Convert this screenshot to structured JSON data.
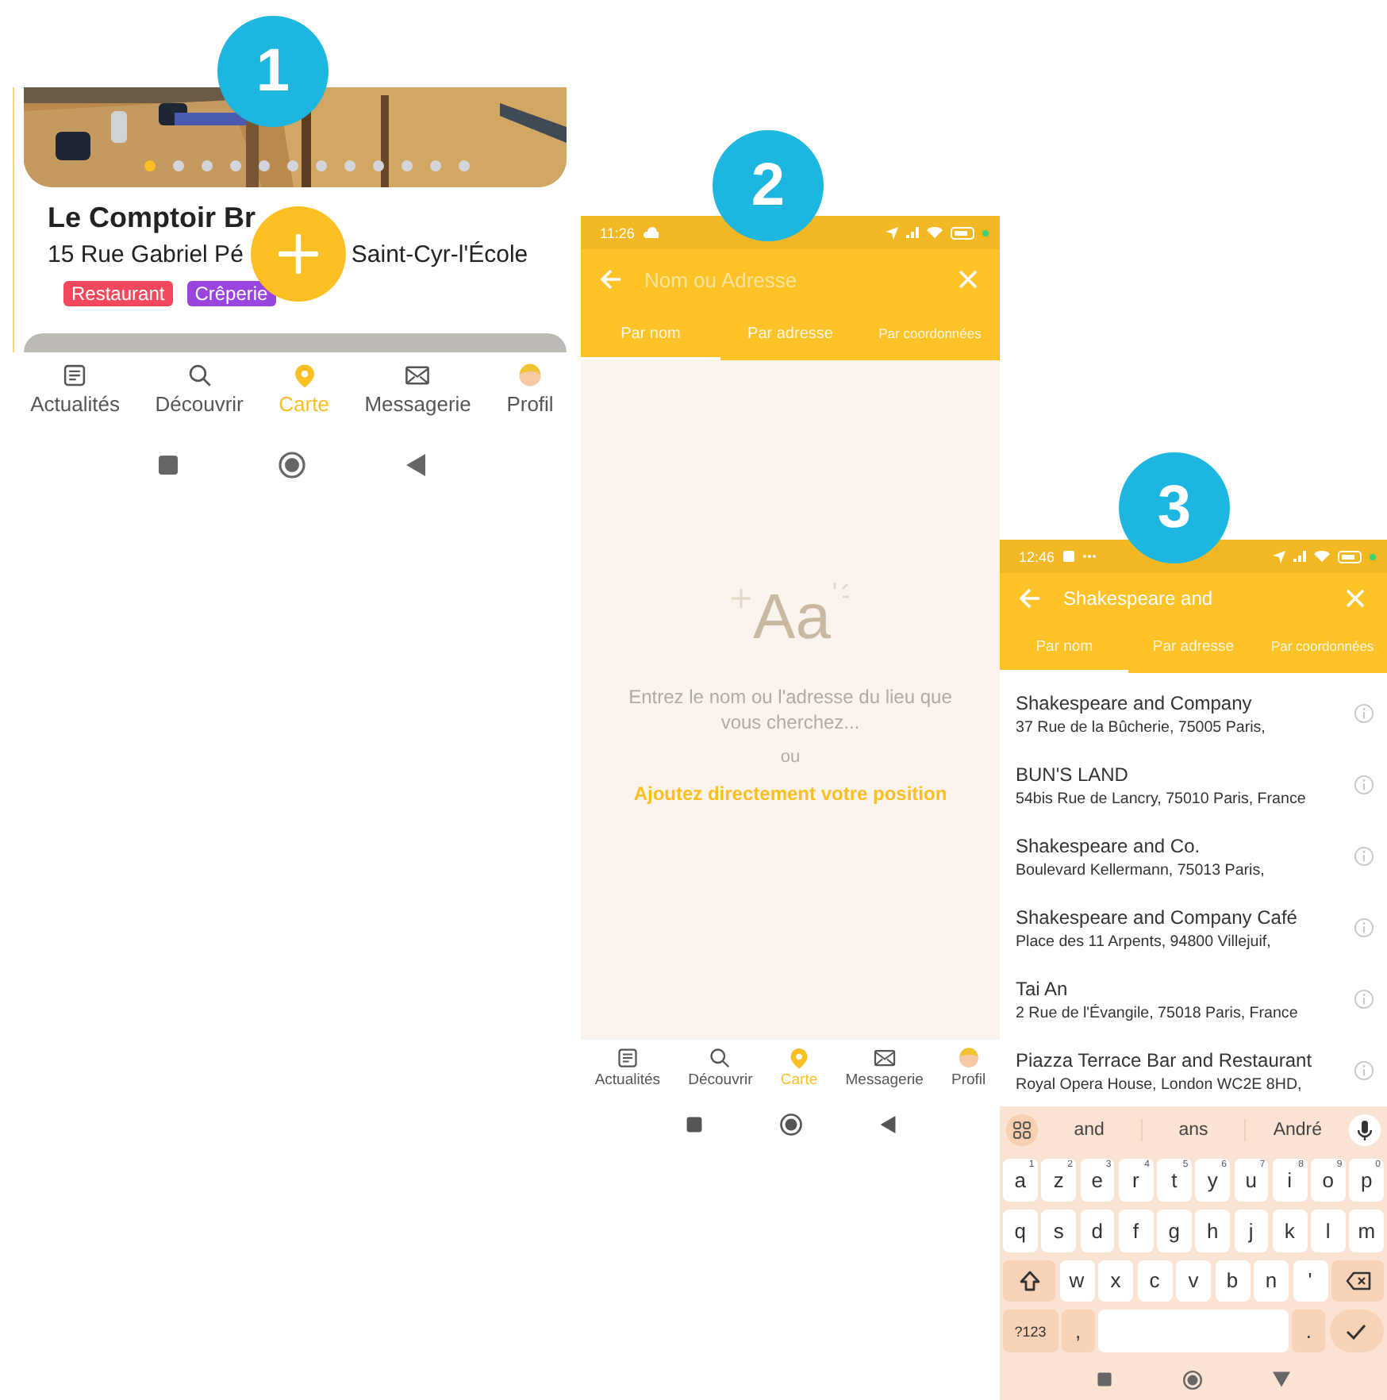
{
  "screen_1": {
    "step": "1",
    "photo": {
      "kind": "picture",
      "dots": [
        {
          "selected": true
        },
        {
          "selected": false
        },
        {
          "selected": false
        },
        {
          "selected": false
        },
        {
          "selected": false
        },
        {
          "selected": false
        },
        {
          "selected": false
        },
        {
          "selected": false
        },
        {
          "selected": false
        },
        {
          "selected": false
        },
        {
          "selected": false
        },
        {
          "selected": false
        }
      ]
    },
    "place": {
      "name": "Le Comptoir Br",
      "address_start": "15 Rue Gabriel Pé",
      "address_end": "Saint-Cyr-l'École",
      "tags": [
        {
          "label": "Restaurant",
          "color": "#f2475c"
        },
        {
          "label": "Crêperie",
          "color": "#9a44e0"
        }
      ]
    },
    "nav": [
      {
        "kind": "news",
        "label": "Actualités",
        "selected": false
      },
      {
        "kind": "search",
        "label": "Découvrir",
        "selected": false
      },
      {
        "kind": "map",
        "label": "Carte",
        "selected": true
      },
      {
        "kind": "mail",
        "label": "Messagerie",
        "selected": false
      },
      {
        "kind": "avatar",
        "label": "Profil",
        "selected": false
      }
    ]
  },
  "screen_2": {
    "step": "2",
    "status": {
      "time": "11:26"
    },
    "search": {
      "placeholder": "Nom ou Adresse"
    },
    "tabs": [
      {
        "label": "Par nom",
        "selected": true
      },
      {
        "label": "Par adresse",
        "selected": false
      },
      {
        "label": "Par coordonnées",
        "selected": false
      }
    ],
    "empty": {
      "illustration": "Aa",
      "message": "Entrez le nom ou l'adresse du lieu que vous cherchez...",
      "separator": "ou",
      "link": "Ajoutez directement votre position"
    },
    "nav": [
      {
        "kind": "news",
        "label": "Actualités",
        "selected": false
      },
      {
        "kind": "search",
        "label": "Découvrir",
        "selected": false
      },
      {
        "kind": "map",
        "label": "Carte",
        "selected": true
      },
      {
        "kind": "mail",
        "label": "Messagerie",
        "selected": false
      },
      {
        "kind": "avatar",
        "label": "Profil",
        "selected": false
      }
    ]
  },
  "screen_3": {
    "step": "3",
    "status": {
      "time": "12:46"
    },
    "search": {
      "value": "Shakespeare and"
    },
    "tabs": [
      {
        "label": "Par nom",
        "selected": true
      },
      {
        "label": "Par adresse",
        "selected": false
      },
      {
        "label": "Par coordonnées",
        "selected": false
      }
    ],
    "results": [
      {
        "name": "Shakespeare and Company",
        "address": "37 Rue de la Bûcherie, 75005 Paris,"
      },
      {
        "name": "BUN'S LAND",
        "address": "54bis Rue de Lancry, 75010 Paris, France"
      },
      {
        "name": "Shakespeare and Co.",
        "address": "Boulevard Kellermann, 75013 Paris,"
      },
      {
        "name": "Shakespeare and Company Café",
        "address": "Place des 11 Arpents, 94800 Villejuif,"
      },
      {
        "name": "Tai An",
        "address": "2 Rue de l'Évangile, 75018 Paris, France"
      },
      {
        "name": "Piazza Terrace Bar and Restaurant",
        "address": "Royal Opera House, London WC2E 8HD,"
      }
    ],
    "keyboard": {
      "suggestions": [
        "and",
        "ans",
        "André"
      ],
      "rows": [
        [
          {
            "kind": "letter",
            "label": "a",
            "hint": "1"
          },
          {
            "kind": "letter",
            "label": "z",
            "hint": "2"
          },
          {
            "kind": "letter",
            "label": "e",
            "hint": "3"
          },
          {
            "kind": "letter",
            "label": "r",
            "hint": "4"
          },
          {
            "kind": "letter",
            "label": "t",
            "hint": "5"
          },
          {
            "kind": "letter",
            "label": "y",
            "hint": "6"
          },
          {
            "kind": "letter",
            "label": "u",
            "hint": "7"
          },
          {
            "kind": "letter",
            "label": "i",
            "hint": "8"
          },
          {
            "kind": "letter",
            "label": "o",
            "hint": "9"
          },
          {
            "kind": "letter",
            "label": "p",
            "hint": "0"
          }
        ],
        [
          {
            "kind": "letter",
            "label": "q"
          },
          {
            "kind": "letter",
            "label": "s"
          },
          {
            "kind": "letter",
            "label": "d"
          },
          {
            "kind": "letter",
            "label": "f"
          },
          {
            "kind": "letter",
            "label": "g"
          },
          {
            "kind": "letter",
            "label": "h"
          },
          {
            "kind": "letter",
            "label": "j"
          },
          {
            "kind": "letter",
            "label": "k"
          },
          {
            "kind": "letter",
            "label": "l"
          },
          {
            "kind": "letter",
            "label": "m"
          }
        ],
        [
          {
            "kind": "shift"
          },
          {
            "kind": "letter",
            "label": "w"
          },
          {
            "kind": "letter",
            "label": "x"
          },
          {
            "kind": "letter",
            "label": "c"
          },
          {
            "kind": "letter",
            "label": "v"
          },
          {
            "kind": "letter",
            "label": "b"
          },
          {
            "kind": "letter",
            "label": "n"
          },
          {
            "kind": "letter",
            "label": "'"
          },
          {
            "kind": "backspace"
          }
        ],
        [
          {
            "kind": "symbols",
            "label": "?123"
          },
          {
            "kind": "punct",
            "label": ","
          },
          {
            "kind": "space"
          },
          {
            "kind": "punct",
            "label": "."
          },
          {
            "kind": "enter"
          }
        ]
      ]
    }
  }
}
